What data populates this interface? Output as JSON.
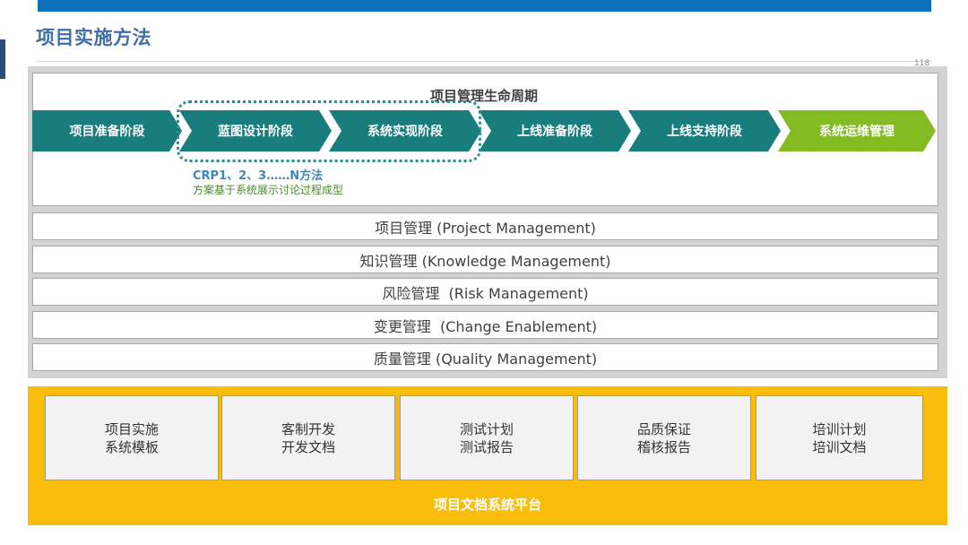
{
  "slide": {
    "title": "项目实施方法",
    "page_number": "118"
  },
  "lifecycle": {
    "title": "项目管理生命周期",
    "phases": [
      {
        "label": "项目准备阶段",
        "color": "#197d7d"
      },
      {
        "label": "蓝图设计阶段",
        "color": "#197d7d"
      },
      {
        "label": "系统实现阶段",
        "color": "#197d7d"
      },
      {
        "label": "上线准备阶段",
        "color": "#197d7d"
      },
      {
        "label": "上线支持阶段",
        "color": "#197d7d"
      },
      {
        "label": "系统运维管理",
        "color": "#84bb22"
      }
    ],
    "crp_label": "CRP1、2、3……N方法",
    "crp_desc": "方案基于系统展示讨论过程成型"
  },
  "management": [
    "项目管理 (Project Management)",
    "知识管理 (Knowledge Management)",
    "风险管理  (Risk Management)",
    "变更管理  (Change Enablement)",
    "质量管理 (Quality Management)"
  ],
  "documents": [
    {
      "line1": "项目实施",
      "line2": "系统模板"
    },
    {
      "line1": "客制开发",
      "line2": "开发文档"
    },
    {
      "line1": "测试计划",
      "line2": "测试报告"
    },
    {
      "line1": "品质保证",
      "line2": "稽核报告"
    },
    {
      "line1": "培训计划",
      "line2": "培训文档"
    }
  ],
  "platform_label": "项目文档系统平台",
  "colors": {
    "top_bar": "#0e6fba",
    "phase_teal": "#197d7d",
    "phase_green": "#84bb22",
    "platform_yellow": "#f7bd0a",
    "title_blue": "#3f6ea8"
  }
}
